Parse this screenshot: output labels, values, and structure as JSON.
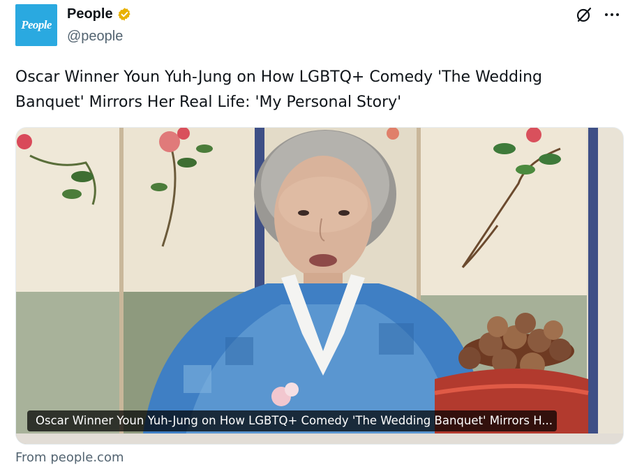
{
  "account": {
    "avatar_text": "People",
    "display_name": "People",
    "handle": "@people",
    "verified_icon": "verified-badge-gold"
  },
  "actions": {
    "grok_icon": "slashed-circle-icon",
    "more_icon": "more-horizontal-icon"
  },
  "tweet": {
    "text": "Oscar Winner Youn Yuh-Jung on How LGBTQ+ Comedy 'The Wedding Banquet' Mirrors Her Real Life: 'My Personal Story'"
  },
  "card": {
    "title": "Oscar Winner Youn Yuh-Jung on How LGBTQ+ Comedy 'The Wedding Banquet' Mirrors H...",
    "source": "From people.com"
  },
  "colors": {
    "brand_blue": "#2aa9e0",
    "verified_gold": "#e8b100",
    "text_primary": "#0f1419",
    "text_secondary": "#536471"
  }
}
